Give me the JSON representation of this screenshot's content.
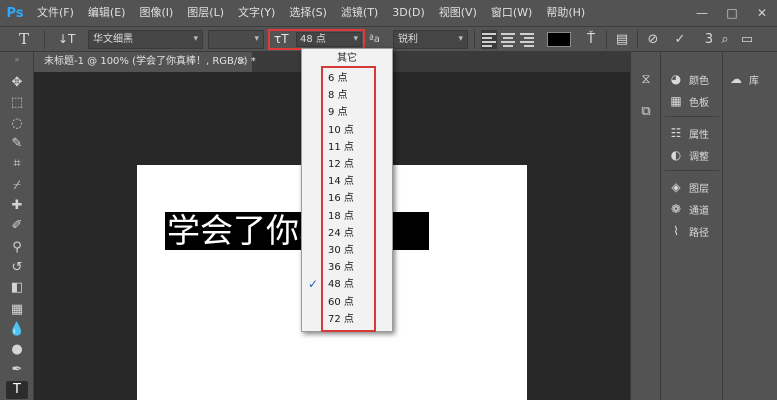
{
  "app": {
    "logo": "Ps"
  },
  "menu": [
    "文件(F)",
    "编辑(E)",
    "图像(I)",
    "图层(L)",
    "文字(Y)",
    "选择(S)",
    "滤镜(T)",
    "3D(D)",
    "视图(V)",
    "窗口(W)",
    "帮助(H)"
  ],
  "window_controls": {
    "minimize": "—",
    "maximize": "□",
    "close": "✕"
  },
  "options": {
    "tool_glyph": "T",
    "orientation_glyph": "↓T",
    "font_family": "华文细黑",
    "font_size": "48 点",
    "aa_glyph": "ªa",
    "antialias": "锐利",
    "text_color": "#000000",
    "size_icon": "τT"
  },
  "document": {
    "tab_title": "未标题-1 @ 100% (学会了你真棒！, RGB/8) *",
    "close_glyph": "×"
  },
  "canvas": {
    "text": "学会了你真棒！"
  },
  "font_size_menu": {
    "header": "其它",
    "options": [
      "6 点",
      "8 点",
      "9 点",
      "10 点",
      "11 点",
      "12 点",
      "14 点",
      "16 点",
      "18 点",
      "24 点",
      "30 点",
      "36 点",
      "48 点",
      "60 点",
      "72 点"
    ],
    "selected": "48 点",
    "check_glyph": "✓"
  },
  "panels": {
    "group1": [
      "颜色",
      "色板"
    ],
    "group2": [
      "属性",
      "调整"
    ],
    "group3": [
      "图层",
      "通道",
      "路径"
    ],
    "library": "库"
  },
  "colors": {
    "accent_red": "#e03a3a",
    "ps_blue": "#31a8ff",
    "check_blue": "#1f5fbf"
  }
}
